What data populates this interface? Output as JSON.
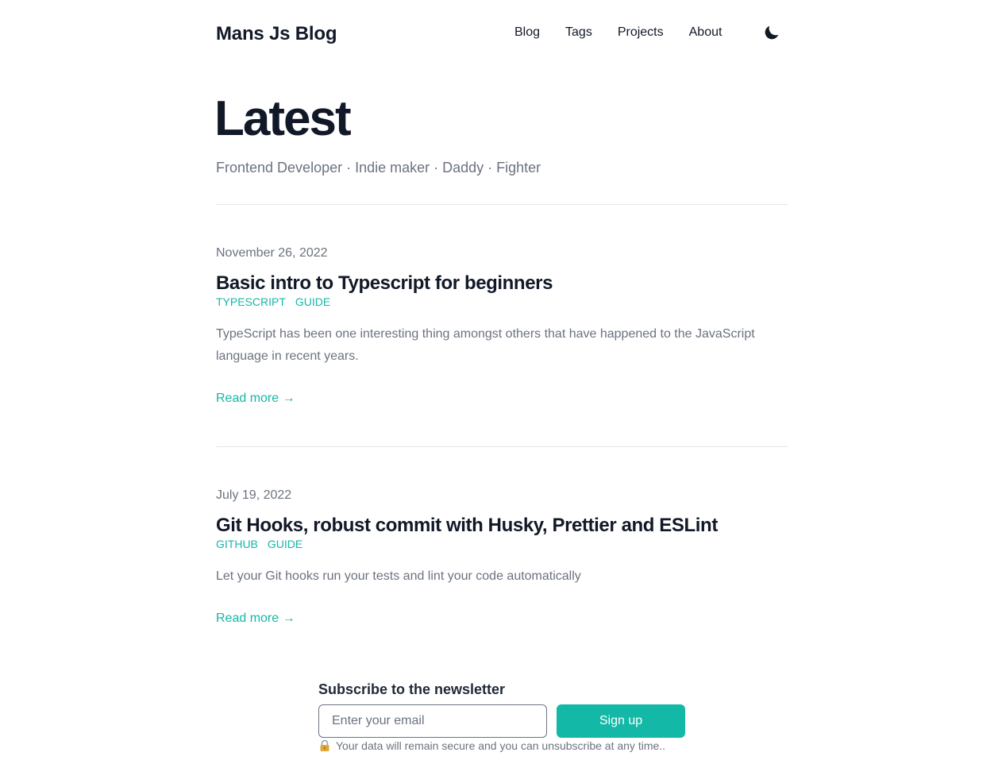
{
  "header": {
    "site_title": "Mans Js Blog",
    "nav": [
      "Blog",
      "Tags",
      "Projects",
      "About"
    ],
    "theme_icon": "moon-icon"
  },
  "hero": {
    "title": "Latest",
    "subtitle": "Frontend Developer · Indie maker · Daddy · Fighter"
  },
  "posts": [
    {
      "date": "November 26, 2022",
      "title": "Basic intro to Typescript for beginners",
      "tags": [
        "typescript",
        "guide"
      ],
      "summary": "TypeScript has been one interesting thing amongst others that have happened to the JavaScript language in recent years.",
      "read_more": "Read more →"
    },
    {
      "date": "July 19, 2022",
      "title": "Git Hooks, robust commit with Husky, Prettier and ESLint",
      "tags": [
        "github",
        "guide"
      ],
      "summary": "Let your Git hooks run your tests and lint your code automatically",
      "read_more": "Read more →"
    }
  ],
  "newsletter": {
    "title": "Subscribe to the newsletter",
    "email_placeholder": "Enter your email",
    "email_value": "",
    "button_label": "Sign up",
    "privacy_note": "Your data will remain secure and you can unsubscribe at any time..",
    "privacy_icon": "lock-icon"
  },
  "colors": {
    "accent": "#14b8a6",
    "text": "#111827",
    "muted": "#6b7280",
    "divider": "#e5e7eb"
  }
}
